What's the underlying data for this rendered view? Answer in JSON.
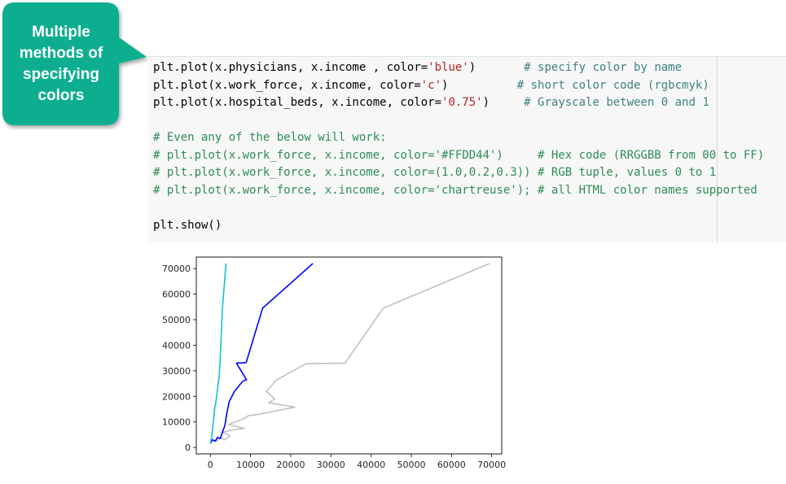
{
  "callout": {
    "text": "Multiple\nmethods of\nspecifying\ncolors",
    "fill": "#0fae8f"
  },
  "code_cell": {
    "lines": [
      [
        {
          "t": "plt.plot(x.physicians, x.income , color="
        },
        {
          "t": "'blue'",
          "c": "str"
        },
        {
          "t": ")       "
        },
        {
          "t": "# specify color by name",
          "c": "cm"
        }
      ],
      [
        {
          "t": "plt.plot(x.work_force, x.income, color="
        },
        {
          "t": "'c'",
          "c": "str"
        },
        {
          "t": ")          "
        },
        {
          "t": "# short color code (rgbcmyk)",
          "c": "cm"
        }
      ],
      [
        {
          "t": "plt.plot(x.hospital_beds, x.income, color="
        },
        {
          "t": "'0.75'",
          "c": "str"
        },
        {
          "t": ")     "
        },
        {
          "t": "# Grayscale between 0 and 1",
          "c": "cm"
        }
      ],
      [
        {
          "t": ""
        }
      ],
      [
        {
          "t": "# Even any of the below will work:",
          "c": "cmg"
        }
      ],
      [
        {
          "t": "# plt.plot(x.work_force, x.income, color='#FFDD44')     # Hex code (RRGGBB from 00 to FF)",
          "c": "cmg"
        }
      ],
      [
        {
          "t": "# plt.plot(x.work_force, x.income, color=(1.0,0.2,0.3)) # RGB tuple, values 0 to 1",
          "c": "cmg"
        }
      ],
      [
        {
          "t": "# plt.plot(x.work_force, x.income, color='chartreuse'); # all HTML color names supported",
          "c": "cmg"
        }
      ],
      [
        {
          "t": ""
        }
      ],
      [
        {
          "t": "plt.show()"
        }
      ]
    ]
  },
  "chart_data": {
    "type": "line",
    "title": "",
    "xlabel": "",
    "ylabel": "",
    "xlim": [
      -3500,
      72500
    ],
    "ylim": [
      -2500,
      74500
    ],
    "x_ticks": [
      0,
      10000,
      20000,
      30000,
      40000,
      50000,
      60000,
      70000
    ],
    "y_ticks": [
      0,
      10000,
      20000,
      30000,
      40000,
      50000,
      60000,
      70000
    ],
    "grid": false,
    "series": [
      {
        "color": "#c0c0c0",
        "points": [
          [
            0,
            2000
          ],
          [
            700,
            3000
          ],
          [
            1500,
            2500
          ],
          [
            2500,
            4000
          ],
          [
            3500,
            3000
          ],
          [
            5000,
            4500
          ],
          [
            3000,
            6000
          ],
          [
            6000,
            7000
          ],
          [
            8500,
            7500
          ],
          [
            4500,
            9000
          ],
          [
            7000,
            10500
          ],
          [
            8000,
            11000
          ],
          [
            9500,
            12500
          ],
          [
            12000,
            13000
          ],
          [
            21000,
            15800
          ],
          [
            14500,
            17500
          ],
          [
            16000,
            19000
          ],
          [
            14000,
            22000
          ],
          [
            16500,
            26500
          ],
          [
            23800,
            32800
          ],
          [
            33500,
            33000
          ],
          [
            43000,
            54500
          ],
          [
            69500,
            72000
          ]
        ]
      },
      {
        "color": "#0000ff",
        "points": [
          [
            0,
            1500
          ],
          [
            500,
            3000
          ],
          [
            1200,
            2500
          ],
          [
            1800,
            4000
          ],
          [
            2500,
            3500
          ],
          [
            3000,
            6000
          ],
          [
            3600,
            8500
          ],
          [
            4000,
            12500
          ],
          [
            4300,
            15000
          ],
          [
            4700,
            18000
          ],
          [
            6000,
            22000
          ],
          [
            8100,
            26000
          ],
          [
            9000,
            26500
          ],
          [
            6500,
            33000
          ],
          [
            8900,
            33200
          ],
          [
            13000,
            54500
          ],
          [
            25500,
            72000
          ]
        ]
      },
      {
        "color": "#17becf",
        "points": [
          [
            0,
            1500
          ],
          [
            300,
            4000
          ],
          [
            600,
            8000
          ],
          [
            900,
            12500
          ],
          [
            1100,
            15800
          ],
          [
            1300,
            17000
          ],
          [
            1700,
            22000
          ],
          [
            2200,
            28000
          ],
          [
            2400,
            33000
          ],
          [
            3000,
            54500
          ],
          [
            3900,
            72000
          ]
        ]
      }
    ]
  }
}
